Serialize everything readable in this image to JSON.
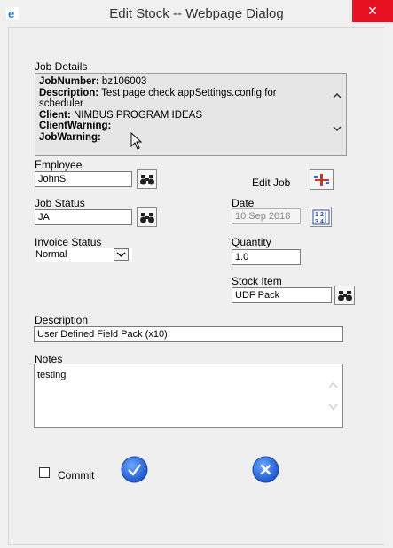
{
  "window": {
    "title": "Edit Stock -- Webpage Dialog",
    "close_glyph": "✕",
    "app_icon": "ie-icon"
  },
  "job_details": {
    "label": "Job Details",
    "lines": [
      {
        "key": "JobNumber:",
        "value": " bz106003"
      },
      {
        "key": "Description:",
        "value": " Test page check appSettings.config for"
      },
      {
        "key": "",
        "value": "scheduler"
      },
      {
        "key": "Client:",
        "value": " NIMBUS PROGRAM IDEAS"
      },
      {
        "key": "ClientWarning:",
        "value": ""
      },
      {
        "key": "JobWarning:",
        "value": ""
      }
    ]
  },
  "employee": {
    "label": "Employee",
    "value": "JohnS"
  },
  "edit_job": {
    "label": "Edit Job"
  },
  "job_status": {
    "label": "Job Status",
    "value": "JA"
  },
  "date": {
    "label": "Date",
    "value": "10 Sep 2018"
  },
  "invoice_status": {
    "label": "Invoice Status",
    "selected": "Normal"
  },
  "quantity": {
    "label": "Quantity",
    "value": "1.0"
  },
  "stock_item": {
    "label": "Stock Item",
    "value": "UDF Pack"
  },
  "description": {
    "label": "Description",
    "value": "User Defined Field Pack (x10)"
  },
  "notes": {
    "label": "Notes",
    "value": "testing"
  },
  "commit": {
    "label": "Commit",
    "checked": false
  },
  "colors": {
    "close_red": "#e81123",
    "round_button_blue": "#2f6fe0"
  }
}
